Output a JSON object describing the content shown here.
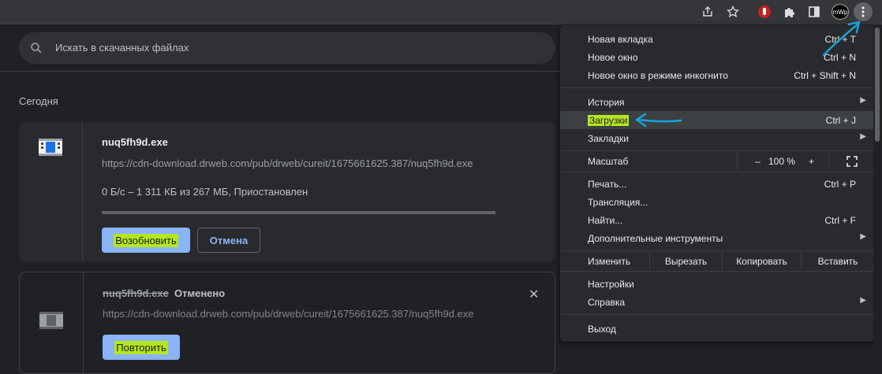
{
  "toolbar": {
    "extension_badge": "mWp",
    "colors": {
      "accent": "#8ab4f8",
      "highlight": "#b5e61d",
      "annotation": "#1ba1d8"
    }
  },
  "search": {
    "placeholder": "Искать в скачанных файлах"
  },
  "section_title": "Сегодня",
  "downloads": [
    {
      "filename": "nuq5fh9d.exe",
      "url": "https://cdn-download.drweb.com/pub/drweb/cureit/1675661625.387/nuq5fh9d.exe",
      "status": "0 Б/с – 1 311 КБ из 267 МБ, Приостановлен",
      "progress": 0.005,
      "resume_label": "Возобновить",
      "cancel_label": "Отмена"
    },
    {
      "filename": "nuq5fh9d.exe",
      "state": "Отменено",
      "url": "https://cdn-download.drweb.com/pub/drweb/cureit/1675661625.387/nuq5fh9d.exe",
      "retry_label": "Повторить"
    }
  ],
  "menu": {
    "new_tab": {
      "label": "Новая вкладка",
      "shortcut": "Ctrl + T"
    },
    "new_window": {
      "label": "Новое окно",
      "shortcut": "Ctrl + N"
    },
    "incognito": {
      "label": "Новое окно в режиме инкогнито",
      "shortcut": "Ctrl + Shift + N"
    },
    "history": {
      "label": "История"
    },
    "downloads": {
      "label": "Загрузки",
      "shortcut": "Ctrl + J"
    },
    "bookmarks": {
      "label": "Закладки"
    },
    "zoom": {
      "label": "Масштаб",
      "minus": "–",
      "value": "100 %",
      "plus": "+"
    },
    "print": {
      "label": "Печать...",
      "shortcut": "Ctrl + P"
    },
    "cast": {
      "label": "Трансляция..."
    },
    "find": {
      "label": "Найти...",
      "shortcut": "Ctrl + F"
    },
    "more_tools": {
      "label": "Дополнительные инструменты"
    },
    "edit": {
      "label": "Изменить",
      "cut": "Вырезать",
      "copy": "Копировать",
      "paste": "Вставить"
    },
    "settings": {
      "label": "Настройки"
    },
    "help": {
      "label": "Справка"
    },
    "exit": {
      "label": "Выход"
    }
  }
}
